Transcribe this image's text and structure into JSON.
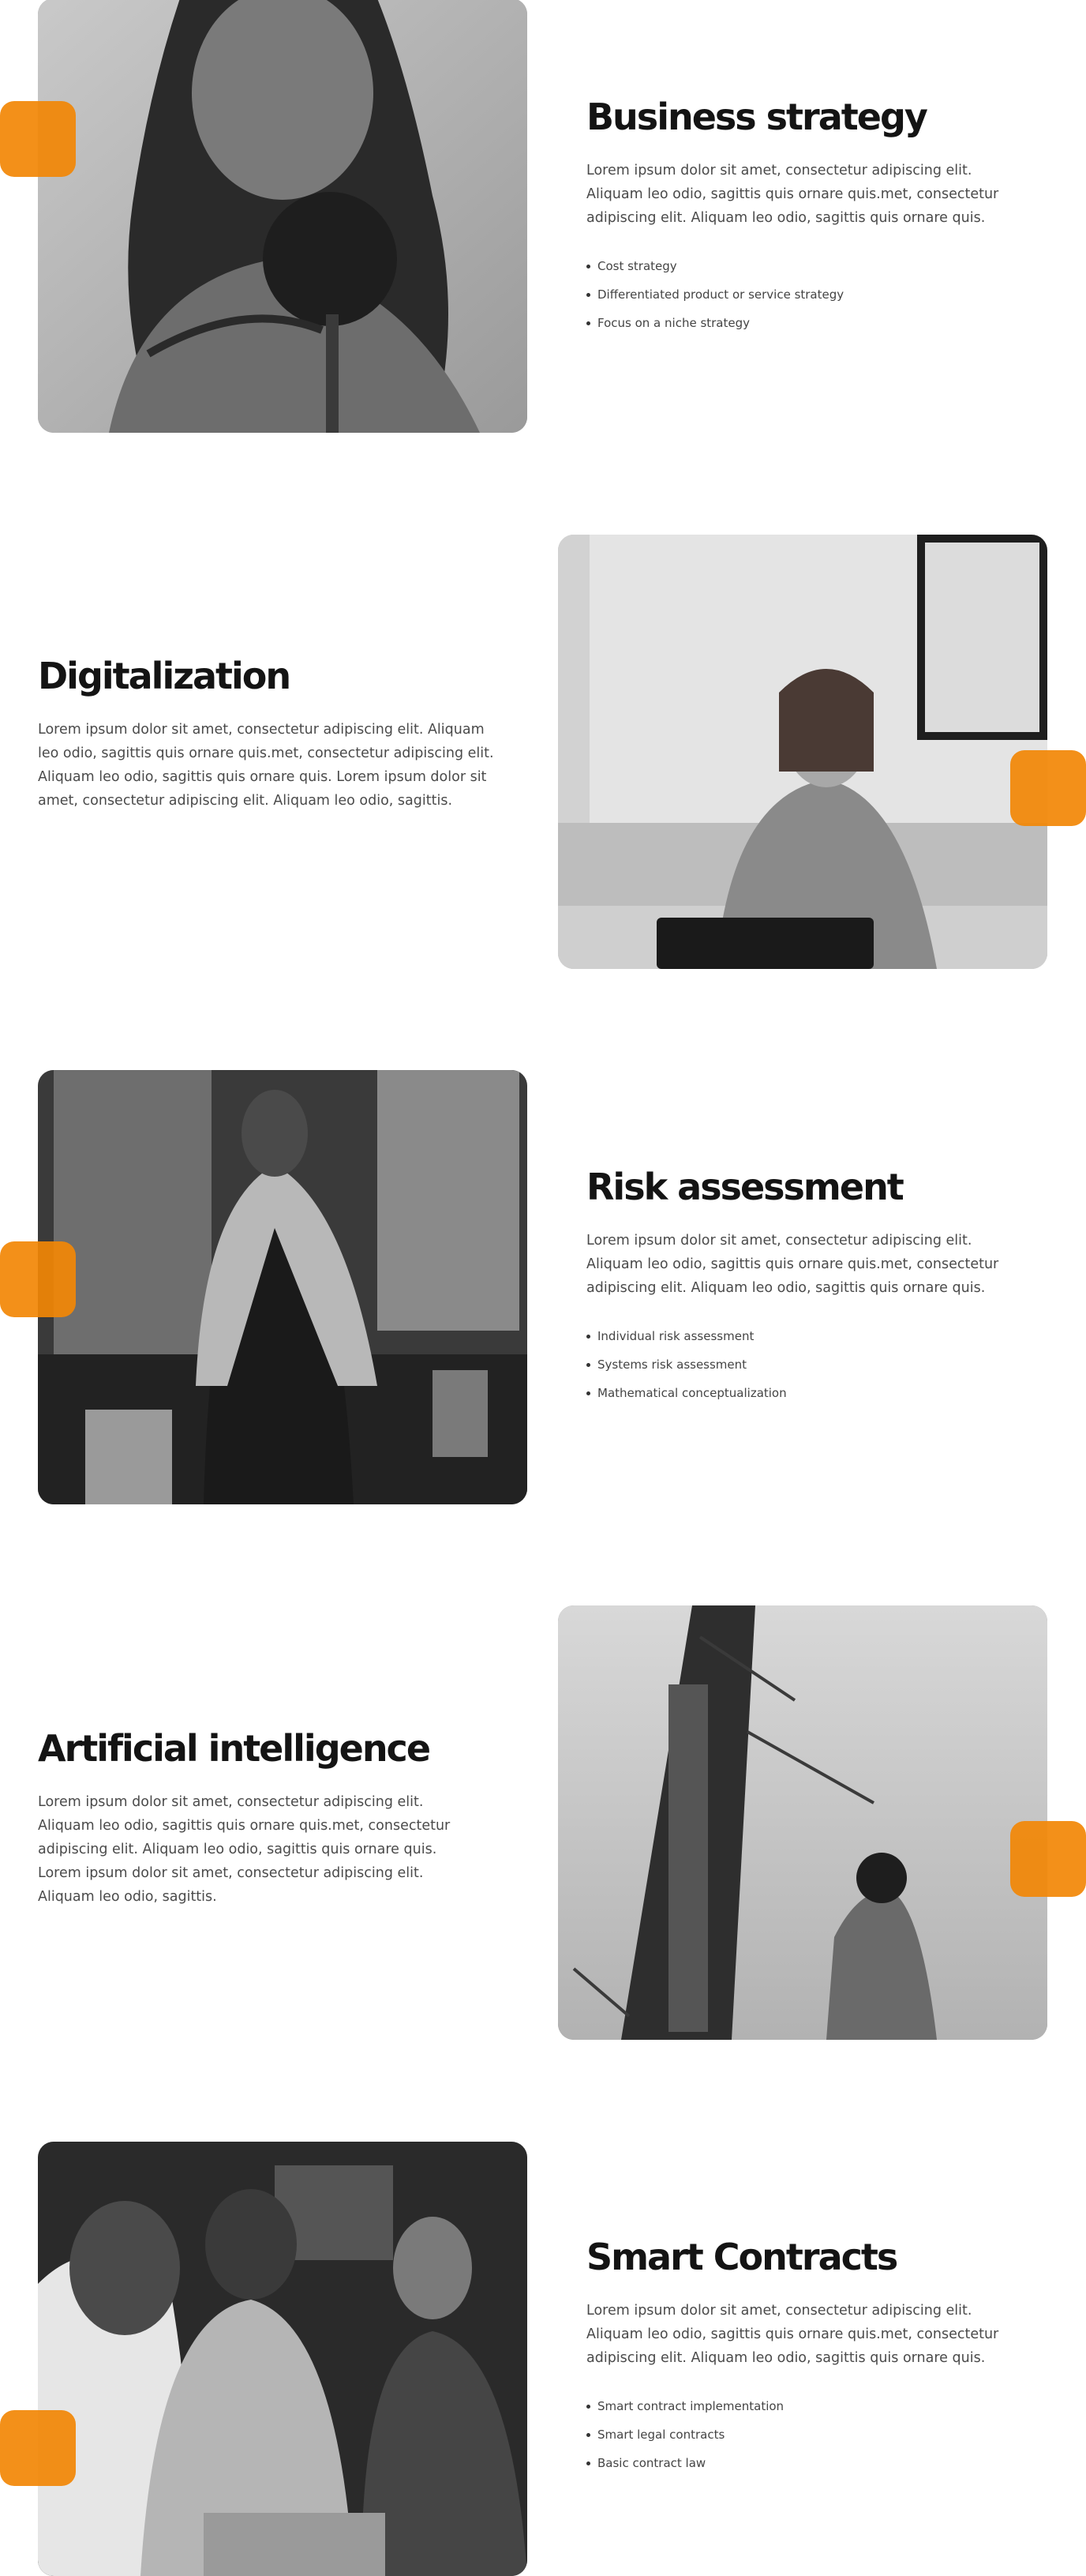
{
  "theme": {
    "accent": "#F28705",
    "heading_color": "#141414",
    "body_color": "#4A4A4A"
  },
  "sections": [
    {
      "heading": "Business strategy",
      "paragraph": "Lorem ipsum dolor sit amet, consectetur adipiscing elit. Aliquam leo odio, sagittis quis ornare quis.met, consectetur adipiscing elit. Aliquam leo odio, sagittis quis ornare quis.",
      "bullets": [
        "Cost strategy",
        "Differentiated product or service strategy",
        "Focus on a niche strategy"
      ],
      "image": "photo-woman-podcast-microphone"
    },
    {
      "heading": "Digitalization",
      "paragraph": "Lorem ipsum dolor sit amet, consectetur adipiscing elit. Aliquam leo odio, sagittis quis ornare quis.met, consectetur adipiscing elit. Aliquam leo odio, sagittis quis ornare quis. Lorem ipsum dolor sit amet, consectetur adipiscing elit. Aliquam leo odio, sagittis.",
      "bullets": [],
      "image": "photo-woman-laptop-coffee"
    },
    {
      "heading": "Risk assessment",
      "paragraph": "Lorem ipsum dolor sit amet, consectetur adipiscing elit. Aliquam leo odio, sagittis quis ornare quis.met, consectetur adipiscing elit. Aliquam leo odio, sagittis quis ornare quis.",
      "bullets": [
        "Individual risk assessment",
        "Systems risk assessment",
        "Mathematical conceptualization"
      ],
      "image": "photo-man-denim-jacket-storefront"
    },
    {
      "heading": "Artificial intelligence",
      "paragraph": "Lorem ipsum dolor sit amet, consectetur adipiscing elit. Aliquam leo odio, sagittis quis ornare quis.met, consectetur adipiscing elit. Aliquam leo odio, sagittis quis ornare quis. Lorem ipsum dolor sit amet, consectetur adipiscing elit. Aliquam leo odio, sagittis.",
      "bullets": [],
      "image": "photo-tower-person-cap"
    },
    {
      "heading": "Smart Contracts",
      "paragraph": "Lorem ipsum dolor sit amet, consectetur adipiscing elit. Aliquam leo odio, sagittis quis ornare quis.met, consectetur adipiscing elit. Aliquam leo odio, sagittis quis ornare quis.",
      "bullets": [
        "Smart contract implementation",
        "Smart legal contracts",
        "Basic contract law"
      ],
      "image": "photo-team-laptop-meeting"
    }
  ]
}
